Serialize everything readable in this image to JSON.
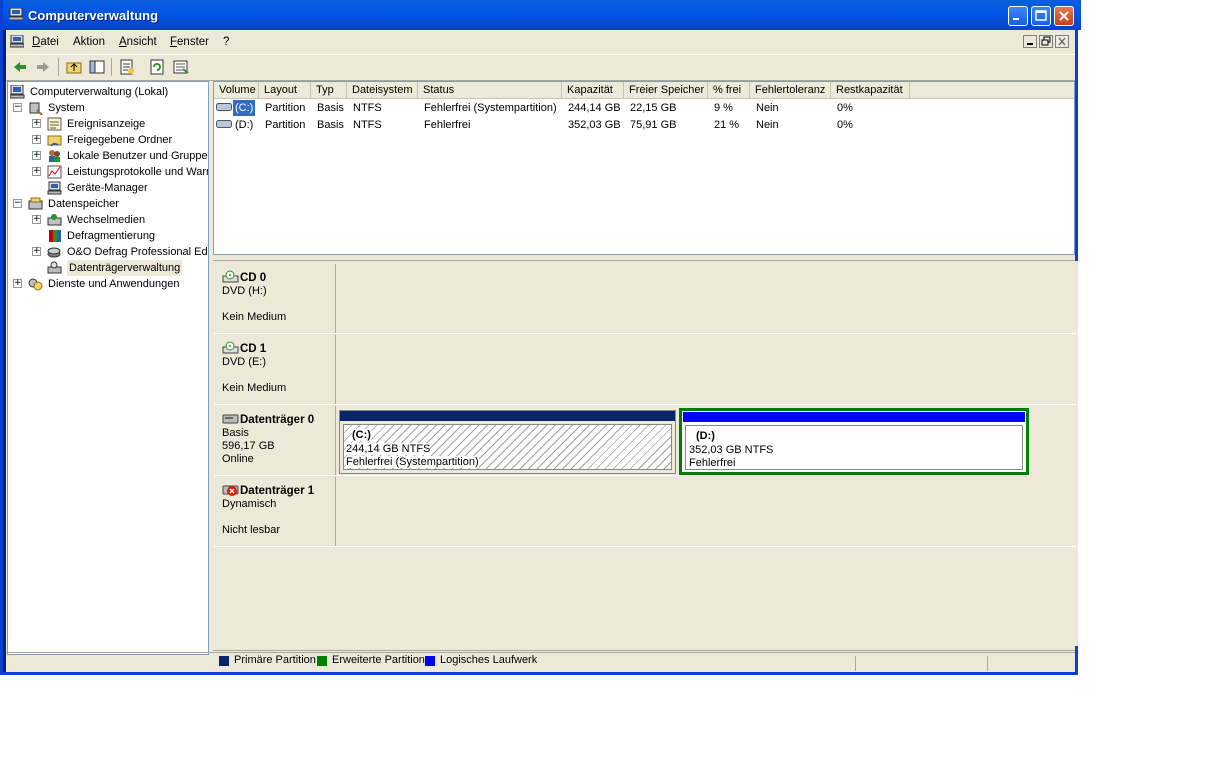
{
  "window": {
    "title": "Computerverwaltung"
  },
  "menu": {
    "items": [
      "Datei",
      "Aktion",
      "Ansicht",
      "Fenster",
      "?"
    ]
  },
  "toolbar": {
    "buttons": [
      "back-icon",
      "forward-icon",
      "up-folder-icon",
      "show-tree-icon",
      "properties-icon",
      "refresh-icon",
      "export-list-icon"
    ]
  },
  "tree": {
    "root": "Computerverwaltung (Lokal)",
    "system": "System",
    "ereignisanzeige": "Ereignisanzeige",
    "freigegebene": "Freigegebene Ordner",
    "lokale_benutzer": "Lokale Benutzer und Gruppen",
    "leistung": "Leistungsprotokolle und Warnungen",
    "geraete": "Geräte-Manager",
    "datenspeicher": "Datenspeicher",
    "wechselmedien": "Wechselmedien",
    "defrag": "Defragmentierung",
    "oo": "O&O Defrag Professional Edition",
    "datentraeger": "Datenträgerverwaltung",
    "dienste": "Dienste und Anwendungen"
  },
  "volumes": {
    "columns": [
      "Volume",
      "Layout",
      "Typ",
      "Dateisystem",
      "Status",
      "Kapazität",
      "Freier Speicher",
      "% frei",
      "Fehlertoleranz",
      "Restkapazität"
    ],
    "rows": [
      [
        "(C:)",
        "Partition",
        "Basis",
        "NTFS",
        "Fehlerfrei (Systempartition)",
        "244,14 GB",
        "22,15 GB",
        "9 %",
        "Nein",
        "0%"
      ],
      [
        "(D:)",
        "Partition",
        "Basis",
        "NTFS",
        "Fehlerfrei",
        "352,03 GB",
        "75,91 GB",
        "21 %",
        "Nein",
        "0%"
      ]
    ]
  },
  "disks": {
    "cd0": {
      "name": "CD 0",
      "line1": "DVD (H:)",
      "line3": "Kein Medium"
    },
    "cd1": {
      "name": "CD 1",
      "line1": "DVD (E:)",
      "line3": "Kein Medium"
    },
    "disk0": {
      "name": "Datenträger 0",
      "line1": "Basis",
      "line2": "596,17 GB",
      "line3": "Online",
      "c": {
        "label": "(C:)",
        "size": "244,14 GB NTFS",
        "status": "Fehlerfrei (Systempartition)"
      },
      "d": {
        "label": "(D:)",
        "size": "352,03 GB NTFS",
        "status": "Fehlerfrei"
      }
    },
    "disk1": {
      "name": "Datenträger 1",
      "line1": "Dynamisch",
      "line3": "Nicht lesbar"
    }
  },
  "legend": {
    "primary": "Primäre Partition",
    "extended": "Erweiterte Partition",
    "logical": "Logisches Laufwerk"
  },
  "colors": {
    "primary": "#0a246a",
    "extended": "#007f00",
    "logical": "#0000ff",
    "title_bar": "#0054e3"
  }
}
